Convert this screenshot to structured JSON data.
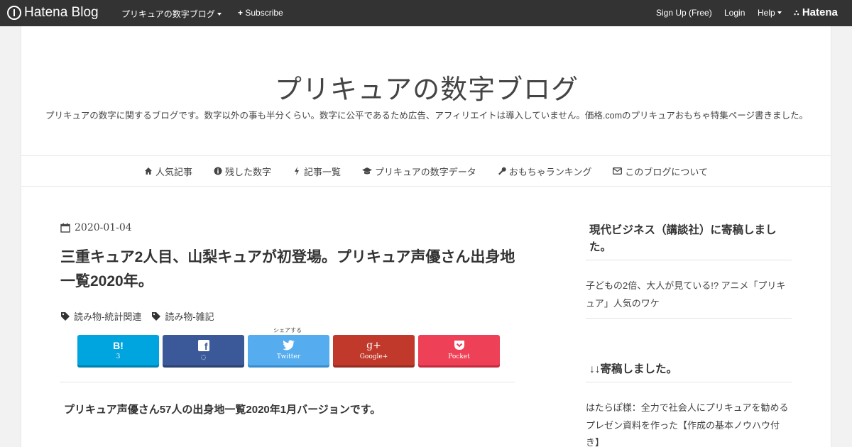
{
  "topbar": {
    "logo_text": "Hatena Blog",
    "blog_menu": "プリキュアの数字ブログ",
    "subscribe": "Subscribe",
    "signup": "Sign Up (Free)",
    "login": "Login",
    "help": "Help",
    "hatena": "Hatena"
  },
  "blog": {
    "title": "プリキュアの数字ブログ",
    "description": "プリキュアの数字に関するブログです。数字以外の事も半分くらい。数字に公平であるため広告、アフィリエイトは導入していません。価格.comのプリキュアおもちゃ特集ページ書きました。"
  },
  "nav": [
    {
      "label": "人気記事",
      "icon": "home-icon"
    },
    {
      "label": "残した数字",
      "icon": "info-icon"
    },
    {
      "label": "記事一覧",
      "icon": "bolt-icon"
    },
    {
      "label": "プリキュアの数字データ",
      "icon": "graduation-cap-icon"
    },
    {
      "label": "おもちゃランキング",
      "icon": "wrench-icon"
    },
    {
      "label": "このブログについて",
      "icon": "envelope-icon"
    }
  ],
  "article": {
    "date": "2020-01-04",
    "title": "三重キュア2人目、山梨キュアが初登場。プリキュア声優さん出身地一覧2020年。",
    "categories": [
      "読み物-統計関連",
      "読み物-雑記"
    ],
    "share_label": "シェアする",
    "share": [
      {
        "icon": "B!",
        "label": "3"
      },
      {
        "icon": "f",
        "label": "◌"
      },
      {
        "icon": "🐦",
        "label": "Twitter"
      },
      {
        "icon": "g+",
        "label": "Google+"
      },
      {
        "icon": "⌄",
        "label": "Pocket"
      }
    ],
    "lead": "プリキュア声優さん57人の出身地一覧2020年1月バージョンです。"
  },
  "sidebar": {
    "section1_title": "現代ビジネス（講談社）に寄稿しました。",
    "section1_link": "子どもの2倍、大人が見ている!? アニメ「プリキュア」人気のワケ",
    "section2_title": "↓↓寄稿しました。",
    "section2_link": "はたらぽ様：全力で社会人にプリキュアを勧めるプレゼン資料を作った【作成の基本ノウハウ付き】"
  }
}
